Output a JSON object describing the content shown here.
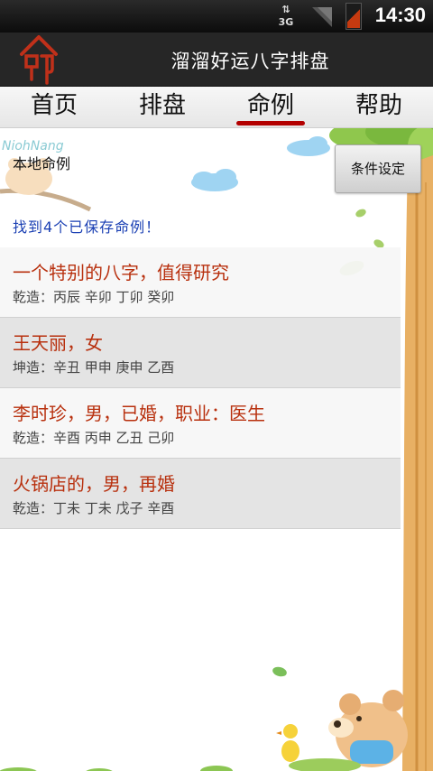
{
  "status_bar": {
    "network": "3G",
    "time": "14:30"
  },
  "app": {
    "title": "溜溜好运八字排盘",
    "logo_icon": "seal-logo-icon"
  },
  "tabs": [
    {
      "label": "首页",
      "active": false
    },
    {
      "label": "排盘",
      "active": false
    },
    {
      "label": "命例",
      "active": true
    },
    {
      "label": "帮助",
      "active": false
    }
  ],
  "content": {
    "section_label": "本地命例",
    "filter_button": "条件设定",
    "found_text": "找到4个已保存命例！",
    "cases": [
      {
        "name": "一个特别的八字，值得研究",
        "bazi": "乾造：丙辰 辛卯 丁卯 癸卯"
      },
      {
        "name": "王天丽，女",
        "bazi": "坤造：辛丑 甲申 庚申 乙酉"
      },
      {
        "name": "李时珍，男，已婚，职业：医生",
        "bazi": "乾造：辛酉 丙申 乙丑 己卯"
      },
      {
        "name": "火锅店的，男，再婚",
        "bazi": "乾造：丁未 丁未 戊子 辛酉"
      }
    ]
  },
  "colors": {
    "accent": "#b30000",
    "case_title": "#b8300e",
    "found_text": "#1a3fb3",
    "titlebar": "#262626"
  }
}
